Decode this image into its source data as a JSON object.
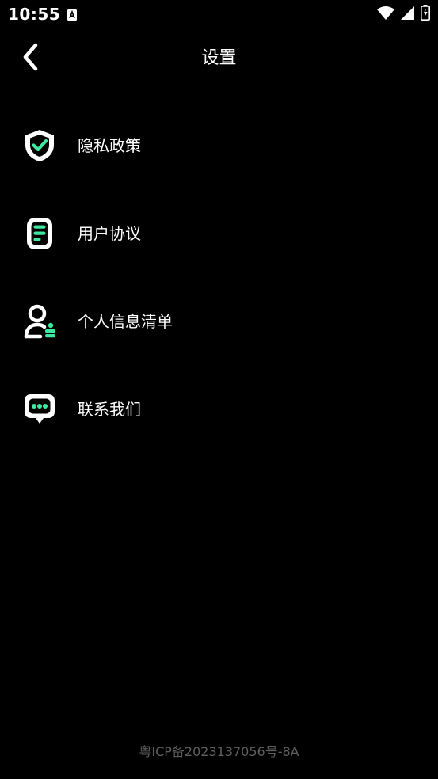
{
  "status_bar": {
    "time": "10:55",
    "notification_icon": "a-square-icon",
    "icons": [
      "wifi-icon",
      "signal-icon",
      "battery-charging-icon"
    ]
  },
  "header": {
    "back_icon": "chevron-left-icon",
    "title": "设置"
  },
  "menu": {
    "items": [
      {
        "label": "隐私政策",
        "icon": "shield-check-icon"
      },
      {
        "label": "用户协议",
        "icon": "document-icon"
      },
      {
        "label": "个人信息清单",
        "icon": "user-list-icon"
      },
      {
        "label": "联系我们",
        "icon": "chat-bubble-icon"
      }
    ]
  },
  "footer": {
    "icp": "粤ICP备2023137056号-8A"
  },
  "colors": {
    "background": "#000000",
    "text": "#ffffff",
    "accent": "#3ee8a0",
    "footer_text": "#5f5f5f"
  }
}
